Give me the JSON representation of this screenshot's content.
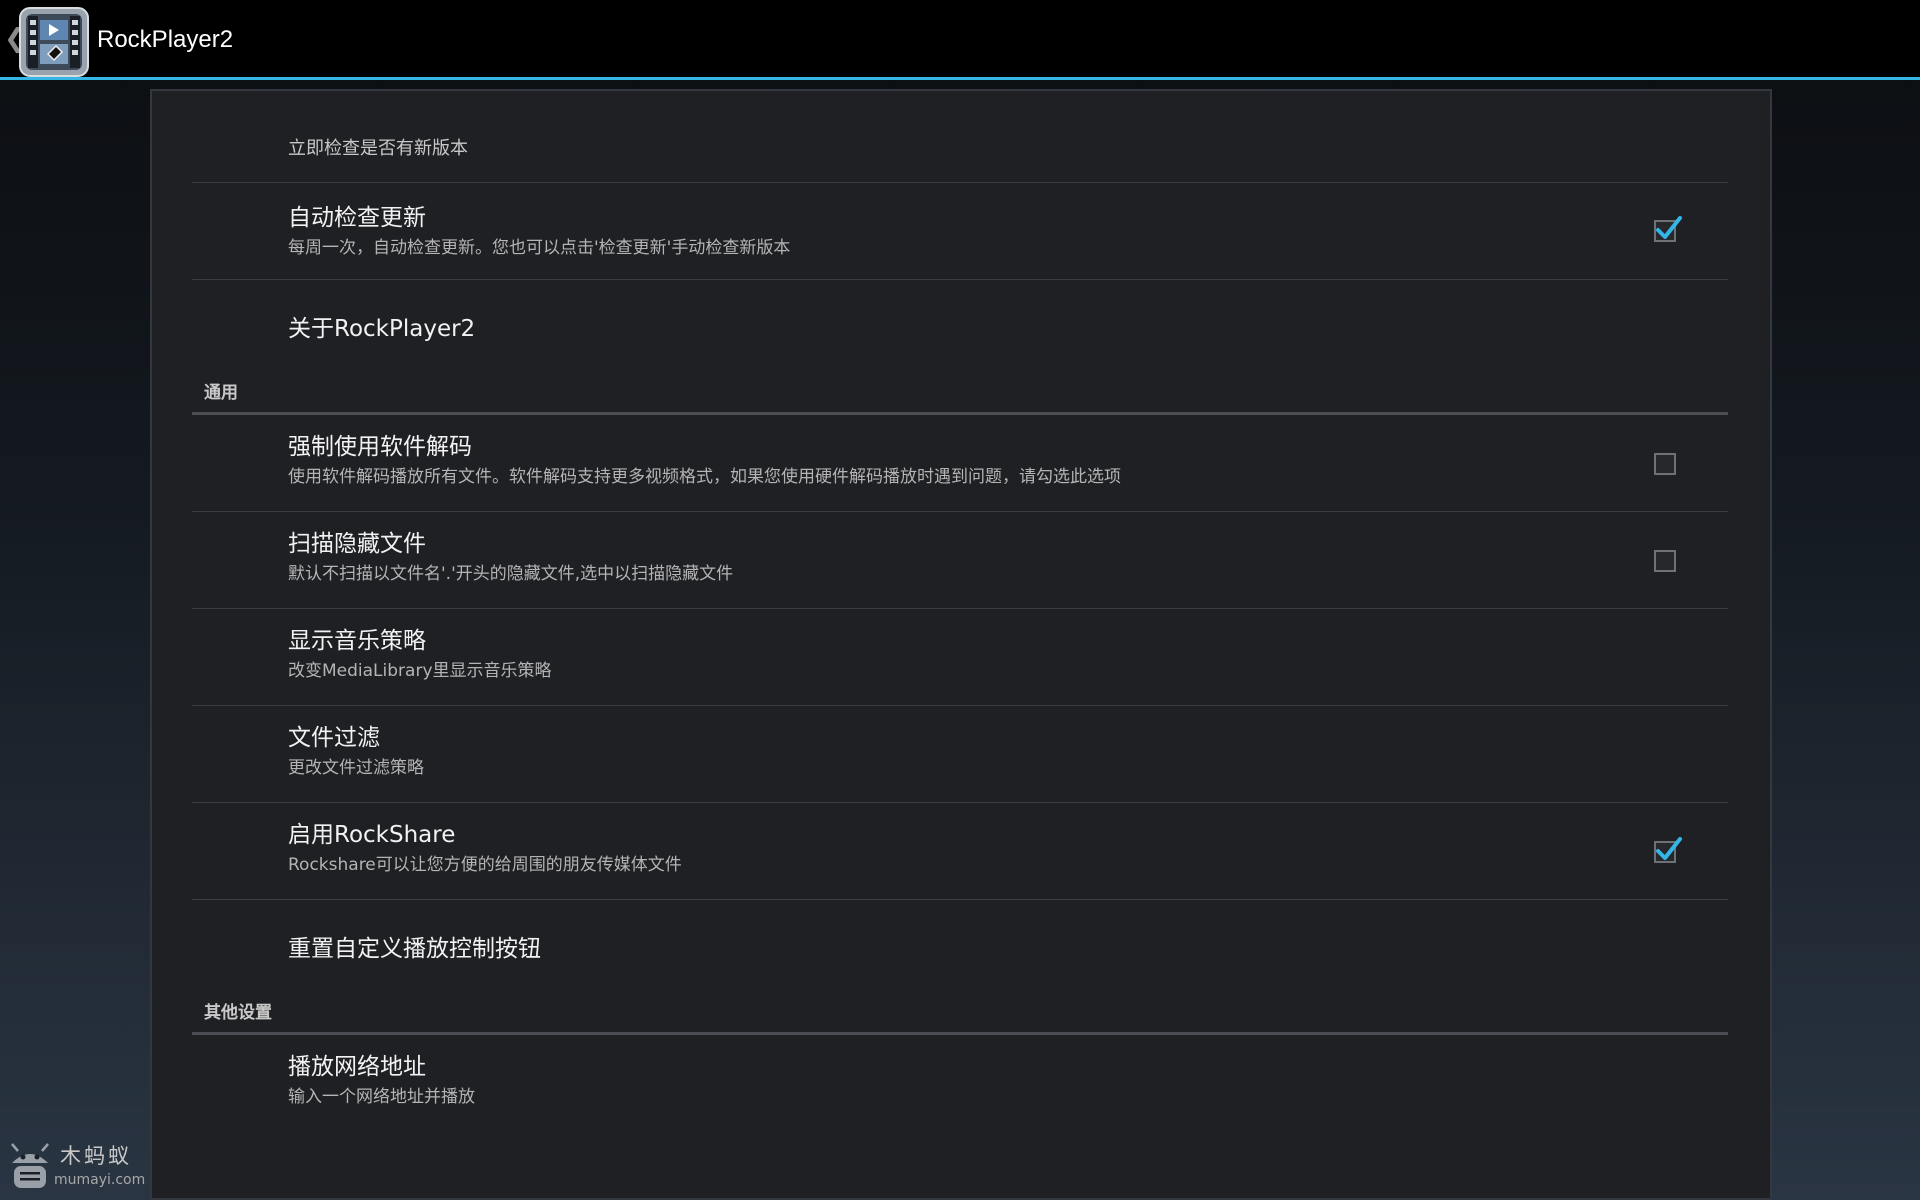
{
  "actionbar": {
    "title": "RockPlayer2",
    "up_icon": "chevron-left-icon",
    "app_icon": "film-clapper-icon",
    "accent_color": "#33b5e5"
  },
  "prefs": {
    "check_update_now": {
      "summary": "立即检查是否有新版本"
    },
    "auto_check_update": {
      "title": "自动检查更新",
      "summary": "每周一次，自动检查更新。您也可以点击'检查更新'手动检查新版本",
      "checked": true
    },
    "about": {
      "title": "关于RockPlayer2"
    },
    "category_general": "通用",
    "force_software_decode": {
      "title": "强制使用软件解码",
      "summary": "使用软件解码播放所有文件。软件解码支持更多视频格式，如果您使用硬件解码播放时遇到问题，请勾选此选项",
      "checked": false
    },
    "scan_hidden_files": {
      "title": "扫描隐藏文件",
      "summary": "默认不扫描以文件名'.'开头的隐藏文件,选中以扫描隐藏文件",
      "checked": false
    },
    "music_display_policy": {
      "title": "显示音乐策略",
      "summary": "改变MediaLibrary里显示音乐策略"
    },
    "file_filter": {
      "title": "文件过滤",
      "summary": "更改文件过滤策略"
    },
    "enable_rockshare": {
      "title": "启用RockShare",
      "summary": "Rockshare可以让您方便的给周围的朋友传媒体文件",
      "checked": true
    },
    "reset_controls": {
      "title": "重置自定义播放控制按钮"
    },
    "category_other": "其他设置",
    "play_network_url": {
      "title": "播放网络地址",
      "summary": "输入一个网络地址并播放"
    }
  },
  "watermark": {
    "text": "木蚂蚁",
    "subtext": "mumayi.com"
  }
}
